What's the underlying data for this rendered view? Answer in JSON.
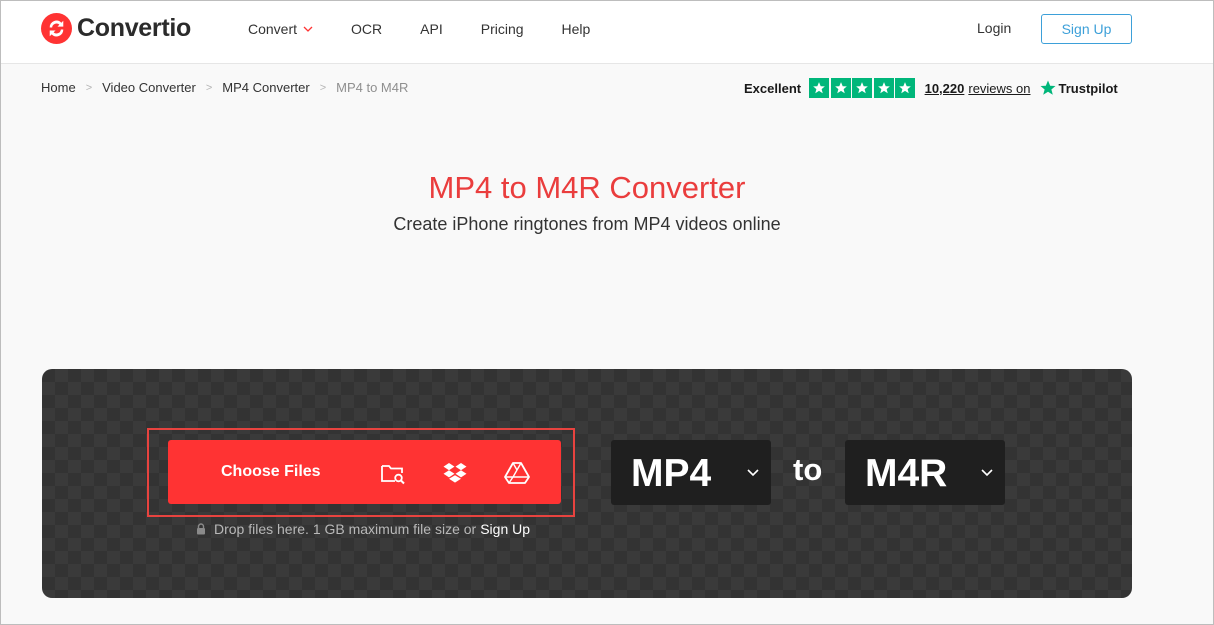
{
  "header": {
    "logo_text": "Convertio",
    "nav": [
      {
        "label": "Convert",
        "has_dropdown": true
      },
      {
        "label": "OCR"
      },
      {
        "label": "API"
      },
      {
        "label": "Pricing"
      },
      {
        "label": "Help"
      }
    ],
    "login_label": "Login",
    "signup_label": "Sign Up"
  },
  "breadcrumb": [
    "Home",
    "Video Converter",
    "MP4 Converter",
    "MP4 to M4R"
  ],
  "trustpilot": {
    "label": "Excellent",
    "rating_stars": 5,
    "reviews_count": "10,220",
    "reviews_text": "reviews on",
    "brand": "Trustpilot"
  },
  "hero": {
    "title": "MP4 to M4R Converter",
    "subtitle": "Create iPhone ringtones from MP4 videos online"
  },
  "converter": {
    "choose_files_label": "Choose Files",
    "icons": [
      "folder-search-icon",
      "dropbox-icon",
      "google-drive-icon"
    ],
    "drop_text": "Drop files here. 1 GB maximum file size or",
    "drop_signup": "Sign Up",
    "from_format": "MP4",
    "to_word": "to",
    "to_format": "M4R"
  },
  "colors": {
    "brand_red": "#ff3333",
    "title_red": "#ea3d3d",
    "link_blue": "#3da0d9",
    "trustpilot_green": "#00b67a"
  }
}
